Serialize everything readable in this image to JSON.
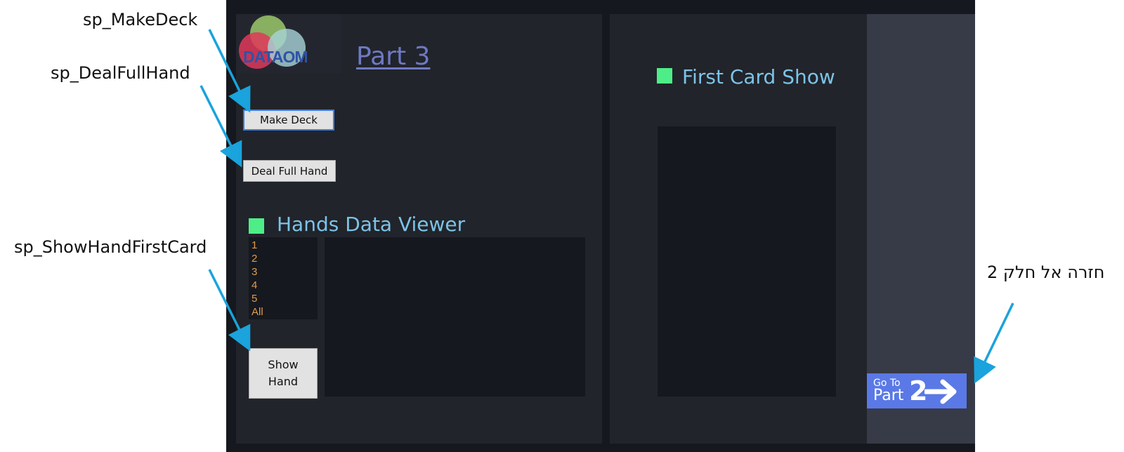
{
  "annotations": {
    "make_deck": "sp_MakeDeck",
    "deal_full_hand": "sp_DealFullHand",
    "show_hand_first_card": "sp_ShowHandFirstCard",
    "back_to_part2": "חזרה אל חלק 2"
  },
  "app": {
    "logo_text": "DATAOM",
    "title": "Part 3",
    "buttons": {
      "make_deck": "Make Deck",
      "deal_full_hand": "Deal Full Hand",
      "show_hand_line1": "Show",
      "show_hand_line2": "Hand"
    },
    "hands_viewer": {
      "title": "Hands Data Viewer",
      "items": [
        "1",
        "2",
        "3",
        "4",
        "5",
        "All"
      ]
    },
    "first_card": {
      "title": "First Card Show"
    },
    "goto": {
      "small": "Go To",
      "big": "Part",
      "number": "2"
    }
  },
  "colors": {
    "accent_square": "#4dee87",
    "section_title": "#7cc3e8",
    "list_text": "#e39a4b",
    "goto_bg": "#5a79e6",
    "arrow": "#1aa3dc"
  }
}
